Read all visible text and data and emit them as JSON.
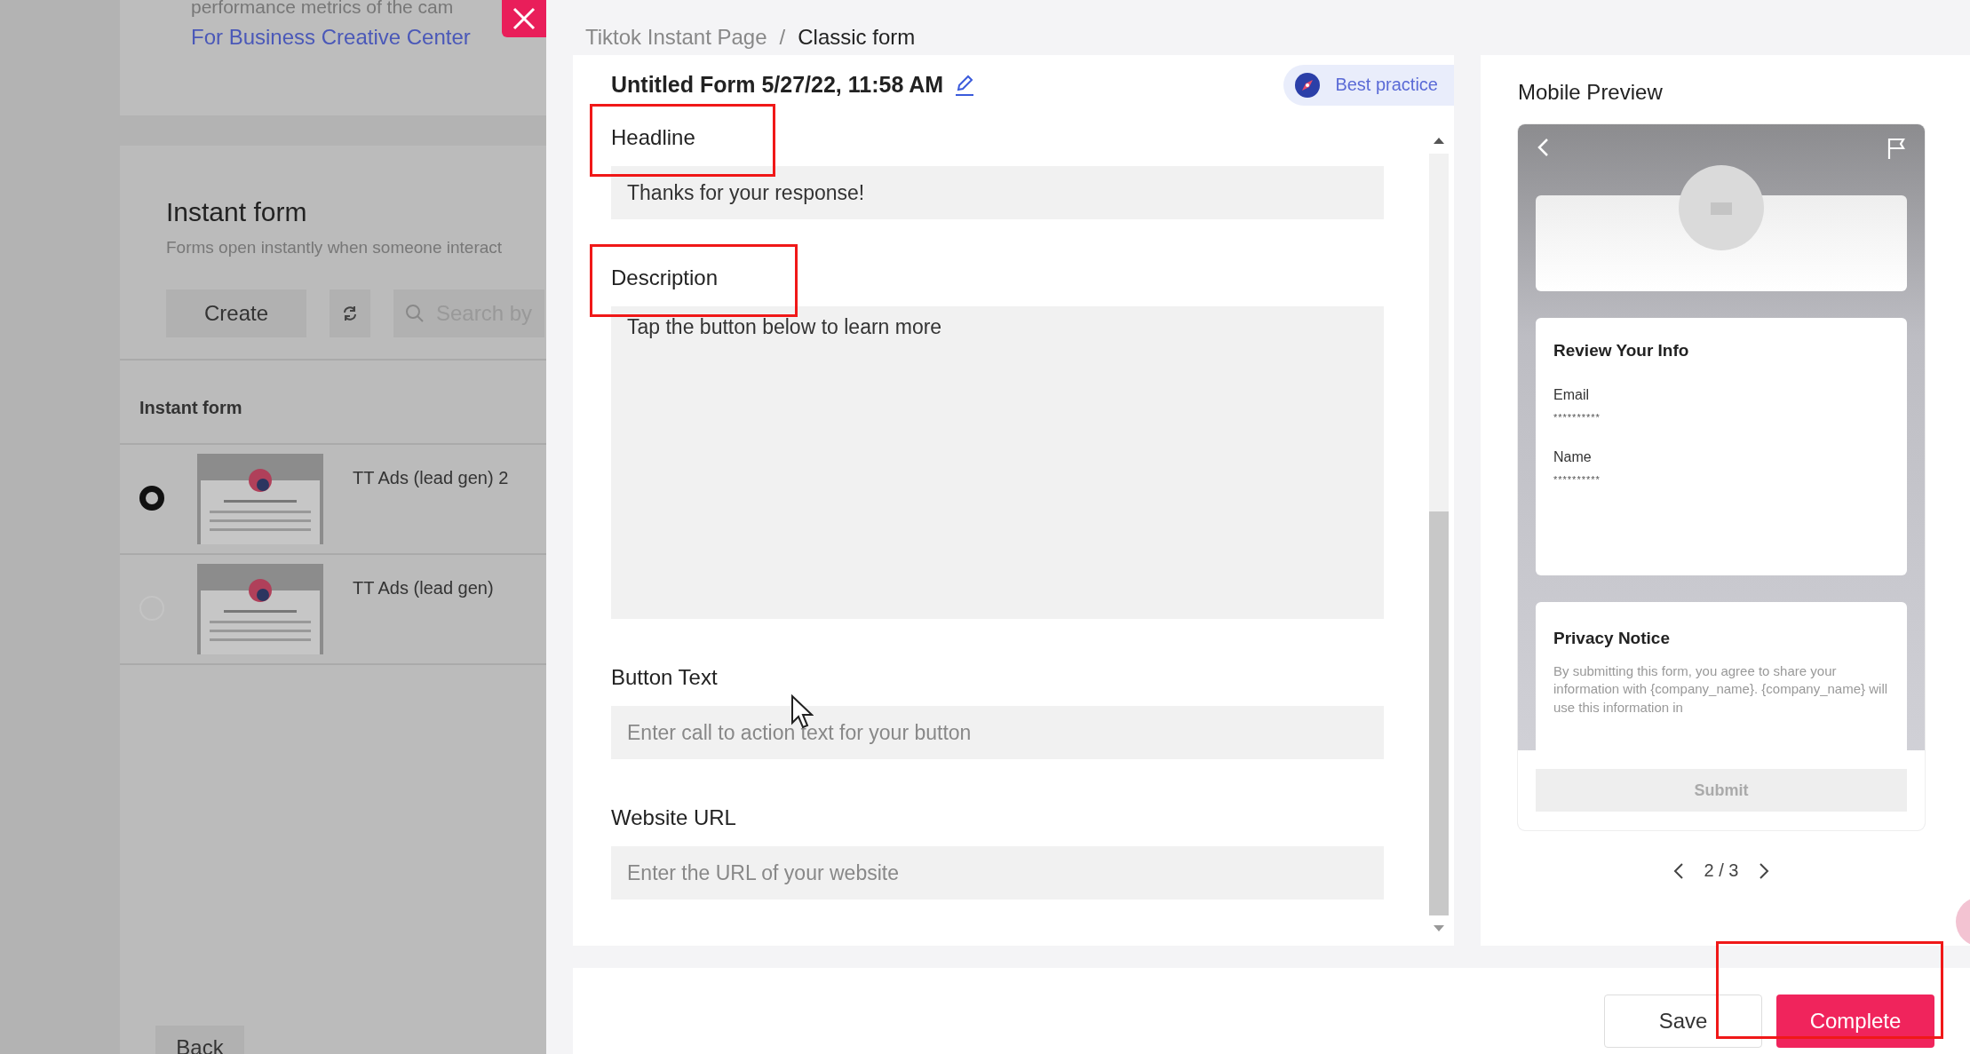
{
  "background_page": {
    "intro_text": "performance metrics of the cam",
    "link": "For Business Creative Center",
    "section_title": "Instant form",
    "section_subtitle": "Forms open instantly when someone interact",
    "create_button": "Create",
    "search": {
      "placeholder": "Search by"
    },
    "table_header": "Instant form",
    "rows": [
      {
        "name": "TT Ads (lead gen) 2",
        "selected": true
      },
      {
        "name": "TT Ads (lead gen)",
        "selected": false
      }
    ],
    "back_button": "Back"
  },
  "breadcrumb": {
    "separator": "/",
    "items": [
      {
        "label": "Tiktok Instant Page",
        "current": false
      },
      {
        "label": "Classic form",
        "current": true
      }
    ]
  },
  "form": {
    "title": "Untitled Form 5/27/22, 11:58 AM",
    "best_practice": "Best practice",
    "fields": [
      {
        "label": "Headline",
        "kind": "input",
        "value": "Thanks for your response!",
        "highlighted": true
      },
      {
        "label": "Description",
        "kind": "textarea",
        "value": "Tap the button below to learn more",
        "highlighted": true
      },
      {
        "label": "Button Text",
        "kind": "input",
        "placeholder": "Enter call to action text for your button"
      },
      {
        "label": "Website URL",
        "kind": "input",
        "placeholder": "Enter the URL of your website"
      }
    ]
  },
  "preview": {
    "title": "Mobile Preview",
    "review_title": "Review Your Info",
    "review_fields": [
      {
        "label": "Email",
        "value": "**********"
      },
      {
        "label": "Name",
        "value": "**********"
      }
    ],
    "privacy_title": "Privacy Notice",
    "privacy_text": "By submitting this form, you agree to share your information with {company_name}. {company_name} will use this information in",
    "submit": "Submit",
    "pager": "2 / 3"
  },
  "footer": {
    "buttons": [
      {
        "label": "Save",
        "kind": "secondary"
      },
      {
        "label": "Complete",
        "kind": "primary",
        "highlighted": true
      }
    ]
  }
}
